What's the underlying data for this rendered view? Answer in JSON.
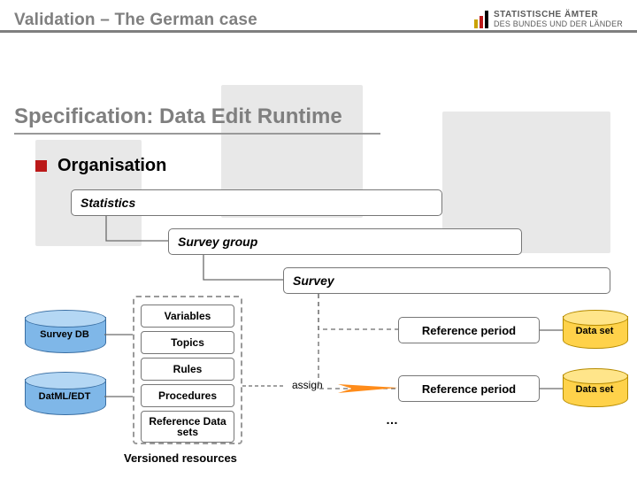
{
  "header": {
    "title": "Validation – The German case"
  },
  "logo": {
    "line1": "STATISTISCHE ÄMTER",
    "line2": "DES BUNDES UND DER LÄNDER"
  },
  "section": {
    "heading": "Specification: Data Edit Runtime"
  },
  "bullet": {
    "text": "Organisation"
  },
  "hier": {
    "statistics": "Statistics",
    "survey_group": "Survey group",
    "survey": "Survey"
  },
  "leftdb": {
    "surveydb": "Survey DB",
    "datml": "DatML/EDT"
  },
  "group": {
    "variables": "Variables",
    "topics": "Topics",
    "rules": "Rules",
    "procedures": "Procedures",
    "refds": "Reference Data sets",
    "label": "Versioned resources"
  },
  "assign": "assign",
  "ref": {
    "p1": "Reference period",
    "p2": "Reference period"
  },
  "dataset": {
    "d1": "Data set",
    "d2": "Data set"
  },
  "ellipsis": "…"
}
